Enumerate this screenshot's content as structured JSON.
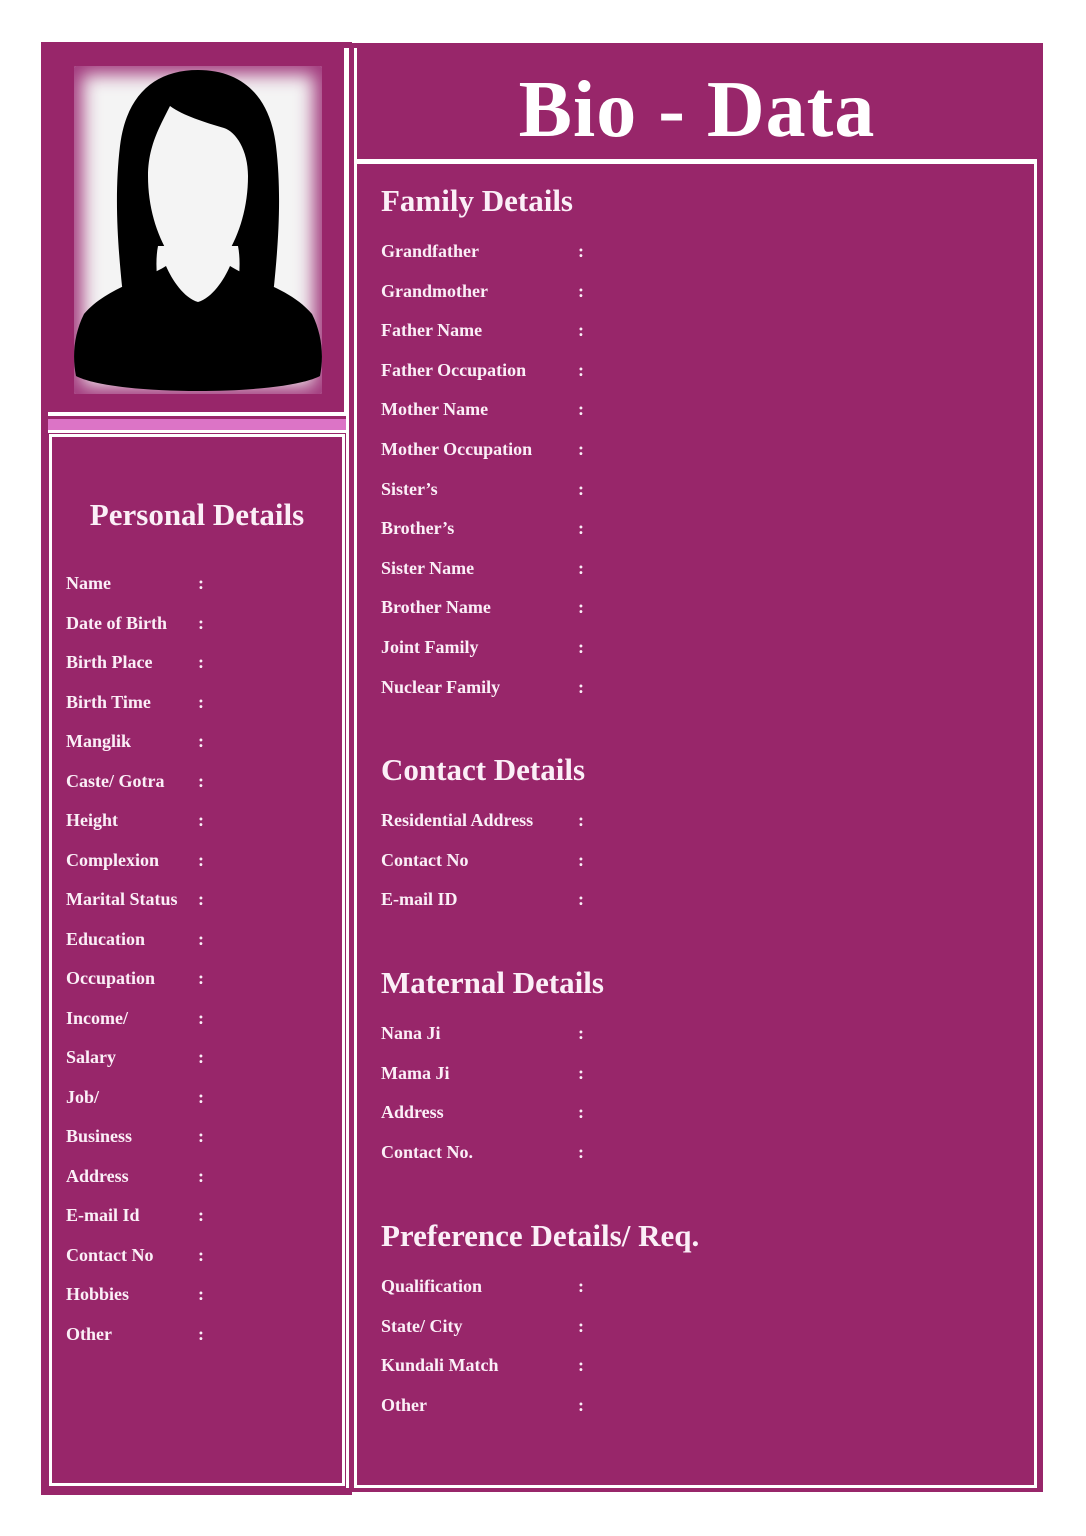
{
  "document": {
    "title": "Bio - Data",
    "colors": {
      "primary": "#98266a",
      "accent_strip": "#dc74c6",
      "frame": "#ffffff",
      "text": "#fbeff7"
    },
    "photo": {
      "icon": "female-avatar-silhouette"
    },
    "separator": ":"
  },
  "personal": {
    "title": "Personal Details",
    "fields": [
      {
        "label": "Name"
      },
      {
        "label": "Date of Birth"
      },
      {
        "label": "Birth Place"
      },
      {
        "label": "Birth Time"
      },
      {
        "label": "Manglik"
      },
      {
        "label": "Caste/ Gotra"
      },
      {
        "label": "Height"
      },
      {
        "label": "Complexion"
      },
      {
        "label": "Marital Status"
      },
      {
        "label": "Education"
      },
      {
        "label": "Occupation"
      },
      {
        "label": "Income/"
      },
      {
        "label": "Salary"
      },
      {
        "label": "Job/"
      },
      {
        "label": "Business"
      },
      {
        "label": "Address"
      },
      {
        "label": "E-mail Id"
      },
      {
        "label": "Contact No"
      },
      {
        "label": "Hobbies"
      },
      {
        "label": "Other"
      }
    ]
  },
  "family": {
    "title": "Family Details",
    "fields": [
      {
        "label": "Grandfather"
      },
      {
        "label": "Grandmother"
      },
      {
        "label": "Father Name"
      },
      {
        "label": "Father Occupation"
      },
      {
        "label": "Mother Name"
      },
      {
        "label": "Mother Occupation"
      },
      {
        "label": "Sister’s"
      },
      {
        "label": "Brother’s"
      },
      {
        "label": "Sister Name"
      },
      {
        "label": "Brother Name"
      },
      {
        "label": "Joint Family"
      },
      {
        "label": "Nuclear Family"
      }
    ]
  },
  "contact": {
    "title": "Contact Details",
    "fields": [
      {
        "label": "Residential Address"
      },
      {
        "label": "Contact No"
      },
      {
        "label": "E-mail ID"
      }
    ]
  },
  "maternal": {
    "title": "Maternal Details",
    "fields": [
      {
        "label": "Nana Ji"
      },
      {
        "label": "Mama Ji"
      },
      {
        "label": "Address"
      },
      {
        "label": "Contact No."
      }
    ]
  },
  "preference": {
    "title": "Preference Details/ Req.",
    "fields": [
      {
        "label": "Qualification"
      },
      {
        "label": "State/ City"
      },
      {
        "label": "Kundali Match"
      },
      {
        "label": "Other"
      }
    ]
  }
}
